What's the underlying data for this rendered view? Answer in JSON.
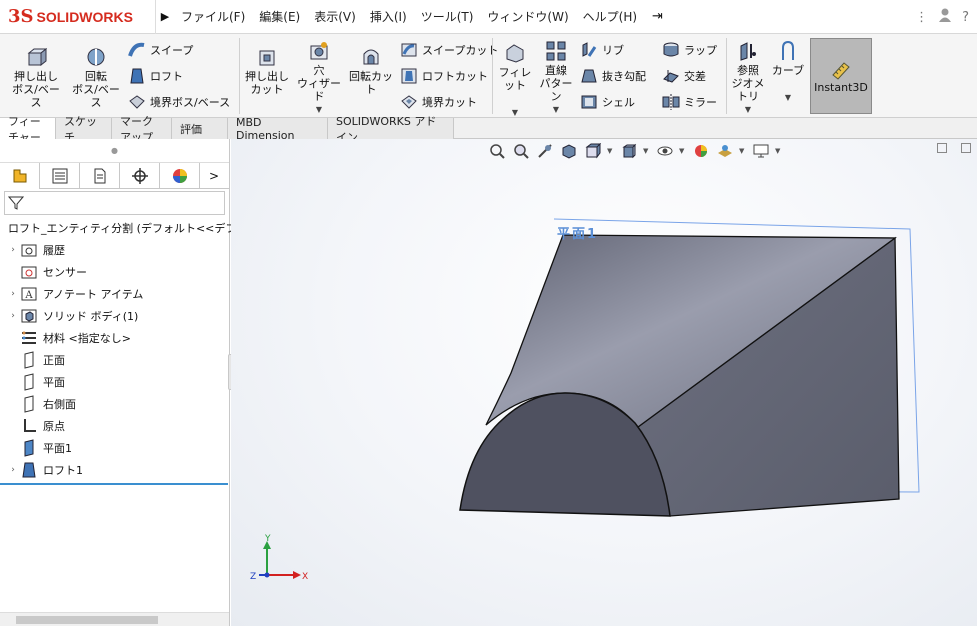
{
  "app": {
    "logo_mark": "3S",
    "logo_text": "SOLIDWORKS"
  },
  "menu": [
    "ファイル(F)",
    "編集(E)",
    "表示(V)",
    "挿入(I)",
    "ツール(T)",
    "ウィンドウ(W)",
    "ヘルプ(H)"
  ],
  "ribbon": {
    "extrude_boss": [
      "押し出し",
      "ボス/ベース"
    ],
    "revolve_boss": [
      "回転",
      "ボス/ベース"
    ],
    "sweep": "スイープ",
    "loft": "ロフト",
    "boundary_boss": "境界ボス/ベース",
    "extrude_cut": [
      "押し出し",
      "カット"
    ],
    "hole_wizard": [
      "穴",
      "ウィザード"
    ],
    "revolve_cut": "回転カット",
    "sweep_cut": "スイープカット",
    "loft_cut": "ロフトカット",
    "boundary_cut": "境界カット",
    "fillet": "フィレット",
    "linear_pattern": [
      "直線",
      "パターン"
    ],
    "rib": "リブ",
    "draft": "抜き勾配",
    "shell": "シェル",
    "wrap": "ラップ",
    "intersect": "交差",
    "mirror": "ミラー",
    "ref_geometry": [
      "参照",
      "ジオメトリ"
    ],
    "curves": "カーブ",
    "instant3d": "Instant3D"
  },
  "tabs": [
    "フィーチャー",
    "スケッチ",
    "マークアップ",
    "評価",
    "MBD Dimension",
    "SOLIDWORKS アドイン"
  ],
  "tree": {
    "root": "ロフト_エンティティ分割  (デフォルト<<デフォルト",
    "items": [
      {
        "label": "履歴",
        "expandable": true
      },
      {
        "label": "センサー",
        "expandable": false
      },
      {
        "label": "アノテート アイテム",
        "expandable": true
      },
      {
        "label": "ソリッド ボディ(1)",
        "expandable": true
      },
      {
        "label": "材料 <指定なし>",
        "expandable": false
      },
      {
        "label": "正面",
        "expandable": false
      },
      {
        "label": "平面",
        "expandable": false
      },
      {
        "label": "右側面",
        "expandable": false
      },
      {
        "label": "原点",
        "expandable": false
      },
      {
        "label": "平面1",
        "expandable": false
      },
      {
        "label": "ロフト1",
        "expandable": true
      }
    ]
  },
  "viewport": {
    "plane_label": "平面1"
  },
  "triad": {
    "x": "X",
    "y": "Y",
    "z": "Z"
  },
  "colors": {
    "accent": "#d52b1e",
    "body": "#6e7180",
    "plane": "#6a9ee6",
    "selection": "#3a8fd0"
  }
}
